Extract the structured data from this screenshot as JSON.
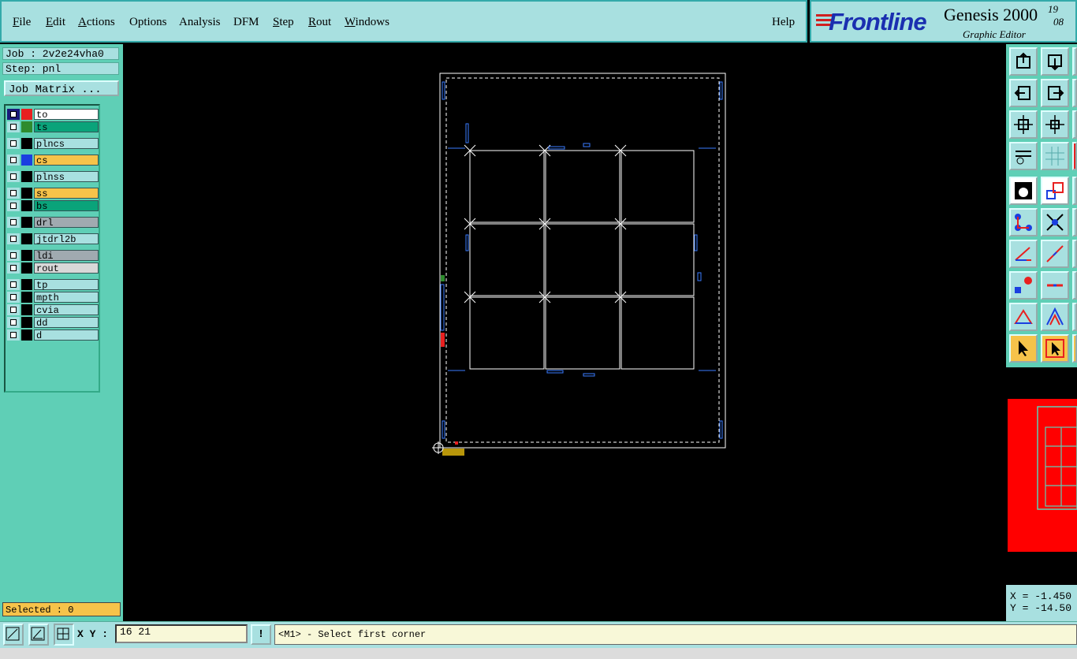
{
  "menu": {
    "items": [
      "File",
      "Edit",
      "Actions",
      "Options",
      "Analysis",
      "DFM",
      "Step",
      "Rout",
      "Windows"
    ],
    "help": "Help"
  },
  "brand": {
    "logo": "Frontline",
    "product": "Genesis 2000",
    "subtitle": "Graphic Editor",
    "version_line1": "19",
    "version_line2": "08"
  },
  "job": {
    "job_label": "Job : 2v2e24vha0",
    "step_label": "Step: pnl",
    "matrix_button": "Job Matrix ..."
  },
  "layers": [
    {
      "name": "to",
      "color": "#ffffff",
      "swatch": "#e82020",
      "checked_dark": true
    },
    {
      "name": "ts",
      "color": "#0aa37a",
      "swatch": "#2e8b2e",
      "checked_dark": false
    },
    {
      "name": "plncs",
      "color": "#a8e0e0",
      "swatch": "#000000",
      "checked_dark": false
    },
    {
      "name": "cs",
      "color": "#f6c34a",
      "swatch": "#1a3fe0",
      "checked_dark": false
    },
    {
      "name": "plnss",
      "color": "#a8e0e0",
      "swatch": "#000000",
      "checked_dark": false
    },
    {
      "name": "ss",
      "color": "#f6c34a",
      "swatch": "#000000",
      "checked_dark": false
    },
    {
      "name": "bs",
      "color": "#0aa37a",
      "swatch": "#000000",
      "checked_dark": false
    },
    {
      "name": "drl",
      "color": "#a0aab0",
      "swatch": "#000000",
      "checked_dark": false
    },
    {
      "name": "jtdrl2b",
      "color": "#a8e0e0",
      "swatch": "#000000",
      "checked_dark": false
    },
    {
      "name": "ldi",
      "color": "#a0aab0",
      "swatch": "#000000",
      "checked_dark": false
    },
    {
      "name": "rout",
      "color": "#d8d8d8",
      "swatch": "#000000",
      "checked_dark": false
    },
    {
      "name": "tp",
      "color": "#a8e0e0",
      "swatch": "#000000",
      "checked_dark": false
    },
    {
      "name": "mpth",
      "color": "#a8e0e0",
      "swatch": "#000000",
      "checked_dark": false
    },
    {
      "name": "cvia",
      "color": "#a8e0e0",
      "swatch": "#000000",
      "checked_dark": false
    },
    {
      "name": "dd",
      "color": "#a8e0e0",
      "swatch": "#000000",
      "checked_dark": false
    },
    {
      "name": "d",
      "color": "#a8e0e0",
      "swatch": "#000000",
      "checked_dark": false
    }
  ],
  "selected": "Selected : 0",
  "coords": {
    "x": "X = -1.450",
    "y": "Y = -14.50"
  },
  "command": {
    "xy_label": "X Y :",
    "xy_value": "16 21",
    "bang": "!",
    "prompt": "<M1> - Select first corner"
  },
  "colors": {
    "panel_bg": "#5fcfb6",
    "menu_bg": "#a8e0e0",
    "highlight": "#f6c34a",
    "logo_blue": "#1a2fb0",
    "overview_red": "#ff0000"
  }
}
